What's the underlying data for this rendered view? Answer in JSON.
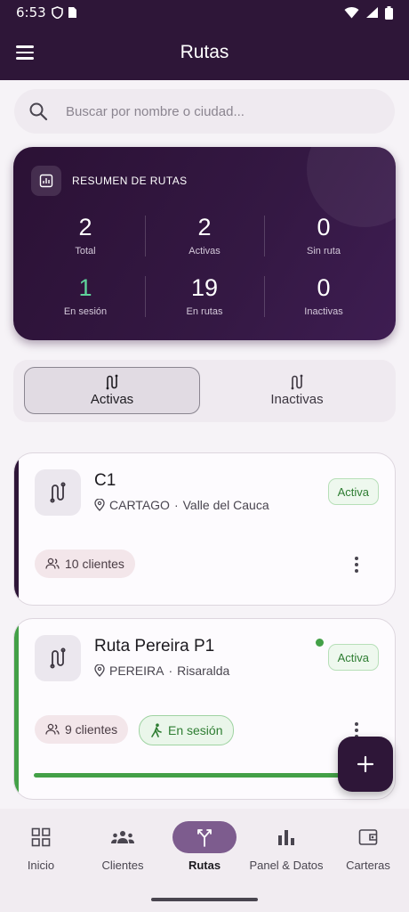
{
  "status_bar": {
    "time": "6:53"
  },
  "app_bar": {
    "title": "Rutas"
  },
  "search": {
    "placeholder": "Buscar por nombre o ciudad..."
  },
  "summary": {
    "title": "RESUMEN DE RUTAS",
    "stats": [
      {
        "value": "2",
        "label": "Total"
      },
      {
        "value": "2",
        "label": "Activas"
      },
      {
        "value": "0",
        "label": "Sin ruta"
      },
      {
        "value": "1",
        "label": "En sesión"
      },
      {
        "value": "19",
        "label": "En rutas"
      },
      {
        "value": "0",
        "label": "Inactivas"
      }
    ]
  },
  "segments": {
    "active_label": "Activas",
    "inactive_label": "Inactivas",
    "selected": "Activas"
  },
  "routes": [
    {
      "name": "C1",
      "city": "CARTAGO",
      "region": "Valle del Cauca",
      "status": "Activa",
      "clients": "10 clientes",
      "in_session": false
    },
    {
      "name": "Ruta Pereira P1",
      "city": "PEREIRA",
      "region": "Risaralda",
      "status": "Activa",
      "clients": "9 clientes",
      "in_session": true,
      "session_label": "En sesión",
      "progress": 1.0
    }
  ],
  "nav": {
    "items": [
      {
        "label": "Inicio",
        "icon": "grid-icon"
      },
      {
        "label": "Clientes",
        "icon": "people-icon"
      },
      {
        "label": "Rutas",
        "icon": "route-fork-icon",
        "active": true
      },
      {
        "label": "Panel & Datos",
        "icon": "bar-chart-icon"
      },
      {
        "label": "Carteras",
        "icon": "wallet-icon"
      }
    ]
  },
  "colors": {
    "primary": "#2e1638",
    "accent_green": "#43a047",
    "active_pill": "#7d5c8e"
  }
}
